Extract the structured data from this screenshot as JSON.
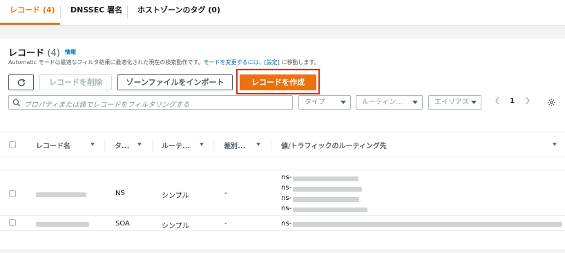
{
  "tabs": [
    {
      "label": "レコード (4)",
      "active": true
    },
    {
      "label": "DNSSEC 署名",
      "active": false
    },
    {
      "label": "ホストゾーンのタグ (0)",
      "active": false
    }
  ],
  "records": {
    "title": "レコード",
    "count": "(4)",
    "info_link": "情報",
    "description_prefix": "Automatic モードは最適なフィルタ結果に最適化された現在の検索動作です。",
    "description_link1": "モードを変更するには、[設定]",
    "description_suffix": " に移動します。",
    "buttons": {
      "refresh": "refresh-icon",
      "delete": "レコードを削除",
      "import": "ゾーンファイルをインポート",
      "create": "レコードを作成"
    },
    "search_placeholder": "プロパティまたは値でレコードをフィルタリングする",
    "filters": {
      "type": "タイプ",
      "routing": "ルーティン...",
      "alias": "エイリアス"
    },
    "pagination": {
      "current_page": "1"
    },
    "columns": [
      "レコード名",
      "タ...",
      "ルーテ...",
      "差別...",
      "値/トラフィックのルーティング先"
    ],
    "rows": [
      {
        "name": "",
        "type": "NS",
        "routing": "シンプル",
        "differentiator": "-",
        "values": [
          "ns-",
          "ns-",
          "ns-",
          "ns-"
        ]
      },
      {
        "name": "",
        "type": "SOA",
        "routing": "シンプル",
        "differentiator": "-",
        "values": [
          "ns-"
        ]
      }
    ]
  },
  "colors": {
    "accent": "#ec7211",
    "link": "#0073bb",
    "highlight": "#d13212"
  }
}
